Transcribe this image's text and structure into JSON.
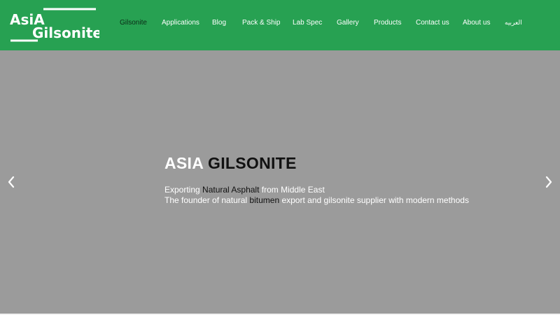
{
  "brand": {
    "line1": "AsiA",
    "line2": "Gilsonite"
  },
  "nav": {
    "items": [
      {
        "label": "Gilsonite",
        "active": true
      },
      {
        "label": "Applications"
      },
      {
        "label": "Blog"
      },
      {
        "label": "Pack & Ship"
      },
      {
        "label": "Lab Spec"
      },
      {
        "label": "Gallery"
      },
      {
        "label": "Products"
      },
      {
        "label": "Contact us"
      },
      {
        "label": "About us"
      },
      {
        "label": "العربیه"
      }
    ]
  },
  "hero": {
    "title_part1": "ASIA",
    "title_part2": "GILSONITE",
    "line1_pre": "Exporting ",
    "line1_highlight": "Natural Asphalt",
    "line1_post": " from Middle East",
    "line2_pre": "The founder of natural ",
    "line2_highlight": "bitumen",
    "line2_post": " export and gilsonite supplier with modern methods"
  },
  "icons": {
    "prev": "chevron-left-icon",
    "next": "chevron-right-icon"
  },
  "colors": {
    "header_bg": "#27a152",
    "hero_bg": "#9b9b9b",
    "active_nav": "#0b2a16",
    "highlight_text": "#111111"
  }
}
